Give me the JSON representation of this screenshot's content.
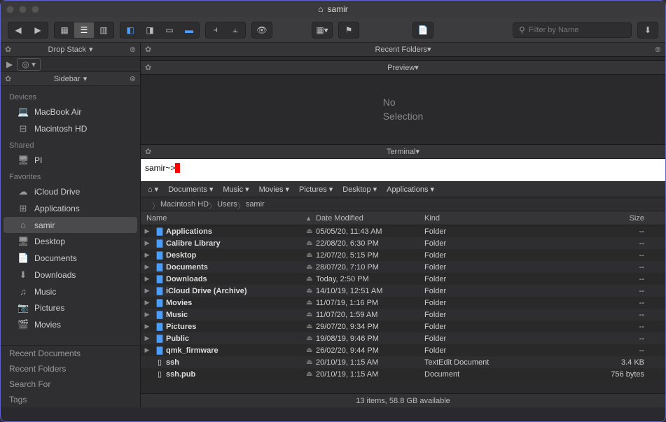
{
  "window": {
    "title": "samir"
  },
  "search": {
    "placeholder": "Filter by Name"
  },
  "dropstack": {
    "label": "Drop Stack"
  },
  "sidebar_label": "Sidebar",
  "sidebar": {
    "sections": [
      {
        "label": "Devices",
        "items": [
          {
            "icon": "laptop",
            "label": "MacBook Air"
          },
          {
            "icon": "disk",
            "label": "Macintosh HD"
          }
        ]
      },
      {
        "label": "Shared",
        "items": [
          {
            "icon": "monitor",
            "label": "PI"
          }
        ]
      },
      {
        "label": "Favorites",
        "items": [
          {
            "icon": "cloud",
            "label": "iCloud Drive"
          },
          {
            "icon": "apps",
            "label": "Applications"
          },
          {
            "icon": "home",
            "label": "samir",
            "selected": true
          },
          {
            "icon": "monitor",
            "label": "Desktop"
          },
          {
            "icon": "doc",
            "label": "Documents"
          },
          {
            "icon": "download",
            "label": "Downloads"
          },
          {
            "icon": "music",
            "label": "Music"
          },
          {
            "icon": "camera",
            "label": "Pictures"
          },
          {
            "icon": "film",
            "label": "Movies"
          }
        ]
      }
    ],
    "footer": [
      "Recent Documents",
      "Recent Folders",
      "Search For",
      "Tags"
    ]
  },
  "recent_folders_label": "Recent Folders",
  "preview": {
    "label": "Preview",
    "no_sel_1": "No",
    "no_sel_2": "Selection"
  },
  "terminal": {
    "label": "Terminal",
    "prompt": "samir~>"
  },
  "pathbar": {
    "home": "⌂",
    "items": [
      "Documents",
      "Music",
      "Movies",
      "Pictures",
      "Desktop",
      "Applications"
    ]
  },
  "breadcrumb": [
    "Macintosh HD",
    "Users",
    "samir"
  ],
  "columns": {
    "name": "Name",
    "date": "Date Modified",
    "kind": "Kind",
    "size": "Size"
  },
  "files": [
    {
      "disc": true,
      "type": "folder",
      "name": "Applications",
      "date": "05/05/20, 11:43 AM",
      "kind": "Folder",
      "size": "--"
    },
    {
      "disc": true,
      "type": "folder",
      "name": "Calibre Library",
      "date": "22/08/20, 6:30 PM",
      "kind": "Folder",
      "size": "--"
    },
    {
      "disc": true,
      "type": "folder",
      "name": "Desktop",
      "date": "12/07/20, 5:15 PM",
      "kind": "Folder",
      "size": "--"
    },
    {
      "disc": true,
      "type": "folder",
      "name": "Documents",
      "date": "28/07/20, 7:10 PM",
      "kind": "Folder",
      "size": "--"
    },
    {
      "disc": true,
      "type": "folder",
      "name": "Downloads",
      "date": "Today, 2:50 PM",
      "kind": "Folder",
      "size": "--"
    },
    {
      "disc": true,
      "type": "folder",
      "name": "iCloud Drive (Archive)",
      "date": "14/10/19, 12:51 AM",
      "kind": "Folder",
      "size": "--"
    },
    {
      "disc": true,
      "type": "folder",
      "name": "Movies",
      "date": "11/07/19, 1:16 PM",
      "kind": "Folder",
      "size": "--"
    },
    {
      "disc": true,
      "type": "folder",
      "name": "Music",
      "date": "11/07/20, 1:59 AM",
      "kind": "Folder",
      "size": "--"
    },
    {
      "disc": true,
      "type": "folder",
      "name": "Pictures",
      "date": "29/07/20, 9:34 PM",
      "kind": "Folder",
      "size": "--"
    },
    {
      "disc": true,
      "type": "folder",
      "name": "Public",
      "date": "19/08/19, 9:46 PM",
      "kind": "Folder",
      "size": "--"
    },
    {
      "disc": true,
      "type": "folder",
      "name": "qmk_firmware",
      "date": "26/02/20, 9:44 PM",
      "kind": "Folder",
      "size": "--"
    },
    {
      "disc": false,
      "type": "file",
      "name": "ssh",
      "date": "20/10/19, 1:15 AM",
      "kind": "TextEdit Document",
      "size": "3.4 KB"
    },
    {
      "disc": false,
      "type": "file",
      "name": "ssh.pub",
      "date": "20/10/19, 1:15 AM",
      "kind": "Document",
      "size": "756 bytes"
    }
  ],
  "status": "13 items, 58.8 GB available",
  "icons": {
    "laptop": "💻",
    "disk": "⊟",
    "monitor": "🖥",
    "cloud": "☁",
    "apps": "⊞",
    "home": "⌂",
    "doc": "📄",
    "download": "⬇",
    "music": "♫",
    "camera": "📷",
    "film": "🎬",
    "folder": "📁",
    "file": "📄",
    "apple": ""
  }
}
